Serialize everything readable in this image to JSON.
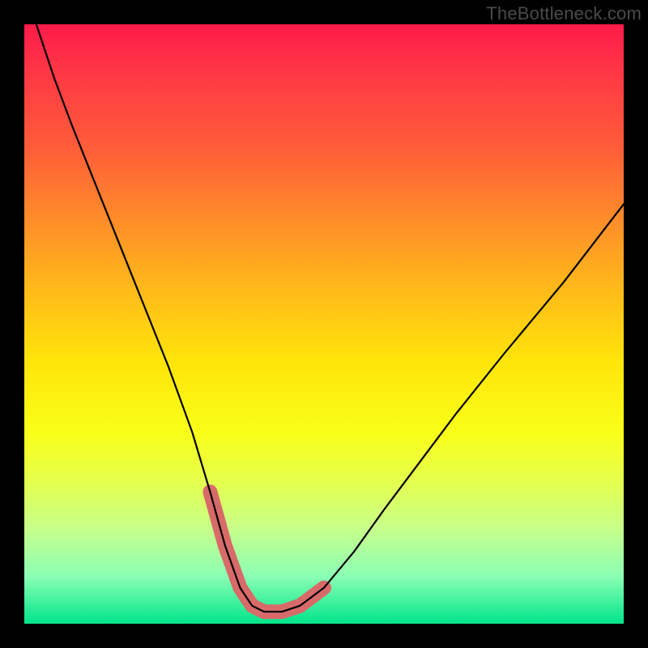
{
  "watermark": "TheBottleneck.com",
  "chart_data": {
    "type": "line",
    "title": "",
    "xlabel": "",
    "ylabel": "",
    "xlim": [
      0,
      100
    ],
    "ylim": [
      0,
      100
    ],
    "series": [
      {
        "name": "bottleneck-curve",
        "x": [
          2,
          5,
          8,
          12,
          16,
          20,
          24,
          28,
          31,
          33.5,
          36,
          38,
          40,
          43,
          46,
          50,
          55,
          60,
          66,
          72,
          80,
          90,
          100
        ],
        "values": [
          100,
          91,
          83,
          73,
          63,
          53,
          43,
          32,
          22,
          13,
          6,
          3,
          2,
          2,
          3,
          6,
          12,
          19,
          27,
          35,
          45,
          57,
          70
        ]
      },
      {
        "name": "optimal-band",
        "x": [
          31,
          33.5,
          36,
          38,
          40,
          43,
          46,
          50
        ],
        "values": [
          22,
          13,
          6,
          3,
          2,
          2,
          3,
          6
        ]
      }
    ],
    "colors": {
      "curve": "#000000",
      "optimal": "#d86a6a"
    }
  }
}
